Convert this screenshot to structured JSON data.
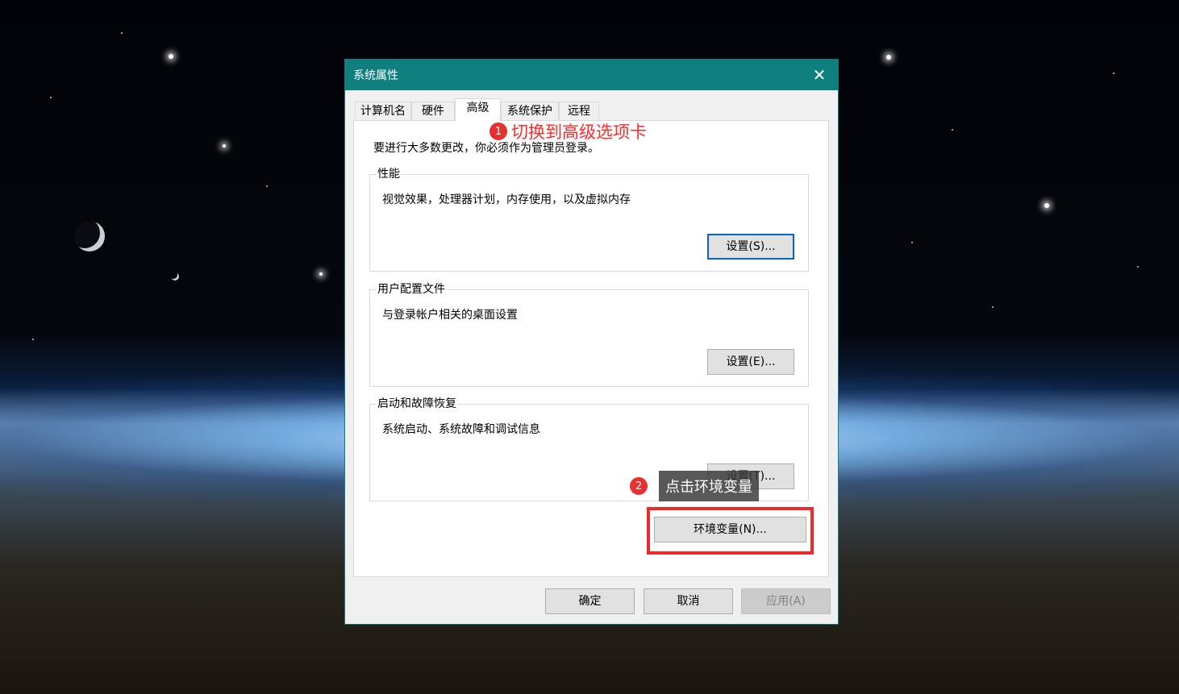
{
  "window": {
    "title": "系统属性"
  },
  "tabs": [
    {
      "label": "计算机名",
      "active": false
    },
    {
      "label": "硬件",
      "active": false
    },
    {
      "label": "高级",
      "active": true
    },
    {
      "label": "系统保护",
      "active": false
    },
    {
      "label": "远程",
      "active": false
    }
  ],
  "panel": {
    "intro": "要进行大多数更改，你必须作为管理员登录。",
    "groups": [
      {
        "label": "性能",
        "description": "视觉效果，处理器计划，内存使用，以及虚拟内存",
        "button": "设置(S)..."
      },
      {
        "label": "用户配置文件",
        "description": "与登录帐户相关的桌面设置",
        "button": "设置(E)..."
      },
      {
        "label": "启动和故障恢复",
        "description": "系统启动、系统故障和调试信息",
        "button": "设置(T)..."
      }
    ],
    "env_button": "环境变量(N)..."
  },
  "footer": {
    "ok": "确定",
    "cancel": "取消",
    "apply": "应用(A)"
  },
  "annotations": [
    {
      "number": "1",
      "text": "切换到高级选项卡",
      "color": "#ff2a2a"
    },
    {
      "number": "2",
      "text": "点击环境变量"
    }
  ],
  "colors": {
    "titlebar": "#0f7f7f",
    "highlight": "#ee2a2a",
    "focus": "#0a64c8"
  },
  "icons": {
    "close": "close-icon"
  }
}
